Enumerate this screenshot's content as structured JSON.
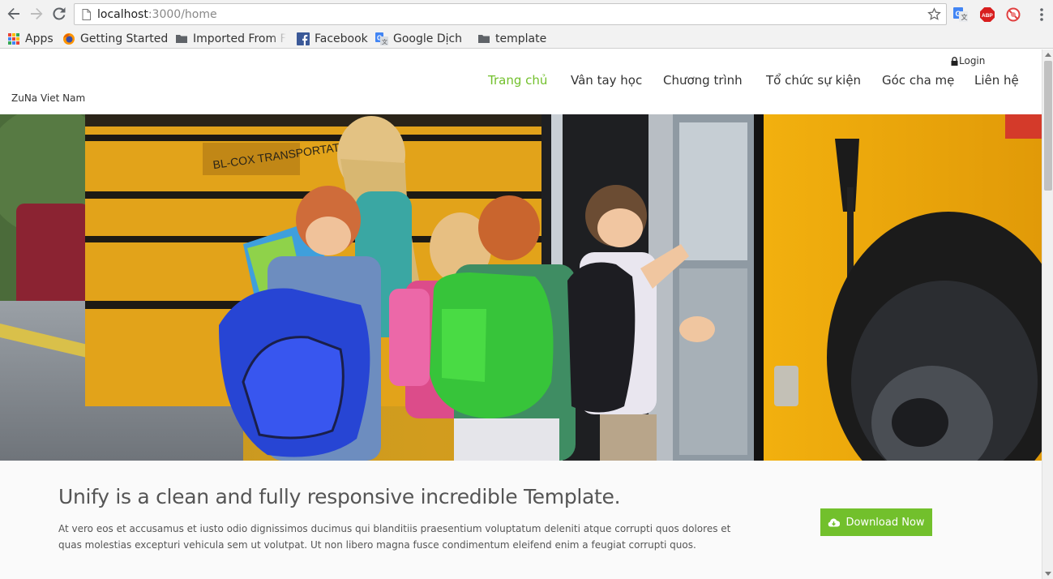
{
  "browser": {
    "url_host": "localhost",
    "url_path": ":3000/home",
    "bookmarks": [
      {
        "label": "Apps",
        "icon": "apps-grid-icon"
      },
      {
        "label": "Getting Started",
        "icon": "firefox-icon"
      },
      {
        "label": "Imported From F",
        "icon": "folder-icon"
      },
      {
        "label": "Facebook",
        "icon": "facebook-icon"
      },
      {
        "label": "Google Dịch",
        "icon": "google-translate-icon"
      },
      {
        "label": "template",
        "icon": "folder-icon"
      }
    ],
    "extensions": [
      "google-translate-icon",
      "adblock-plus-icon",
      "no-sign-extension-icon"
    ]
  },
  "header": {
    "logo": "ZuNa Viet Nam",
    "login": "Login",
    "menu": [
      {
        "label": "Trang chủ",
        "active": true
      },
      {
        "label": "Vân tay học",
        "active": false
      },
      {
        "label": "Chương trình",
        "active": false
      },
      {
        "label": "Tổ chức sự kiện",
        "active": false
      },
      {
        "label": "Góc cha mẹ",
        "active": false
      },
      {
        "label": "Liên hệ",
        "active": false
      }
    ]
  },
  "promo": {
    "title": "Unify is a clean and fully responsive incredible Template.",
    "body": "At vero eos et accusamus et iusto odio dignissimos ducimus qui blanditiis praesentium voluptatum deleniti atque corrupti quos dolores et quas molestias excepturi vehicula sem ut volutpat. Ut non libero magna fusce condimentum eleifend enim a feugiat corrupti quos.",
    "button": "Download Now"
  },
  "colors": {
    "accent": "#72c02c",
    "text": "#333333"
  }
}
